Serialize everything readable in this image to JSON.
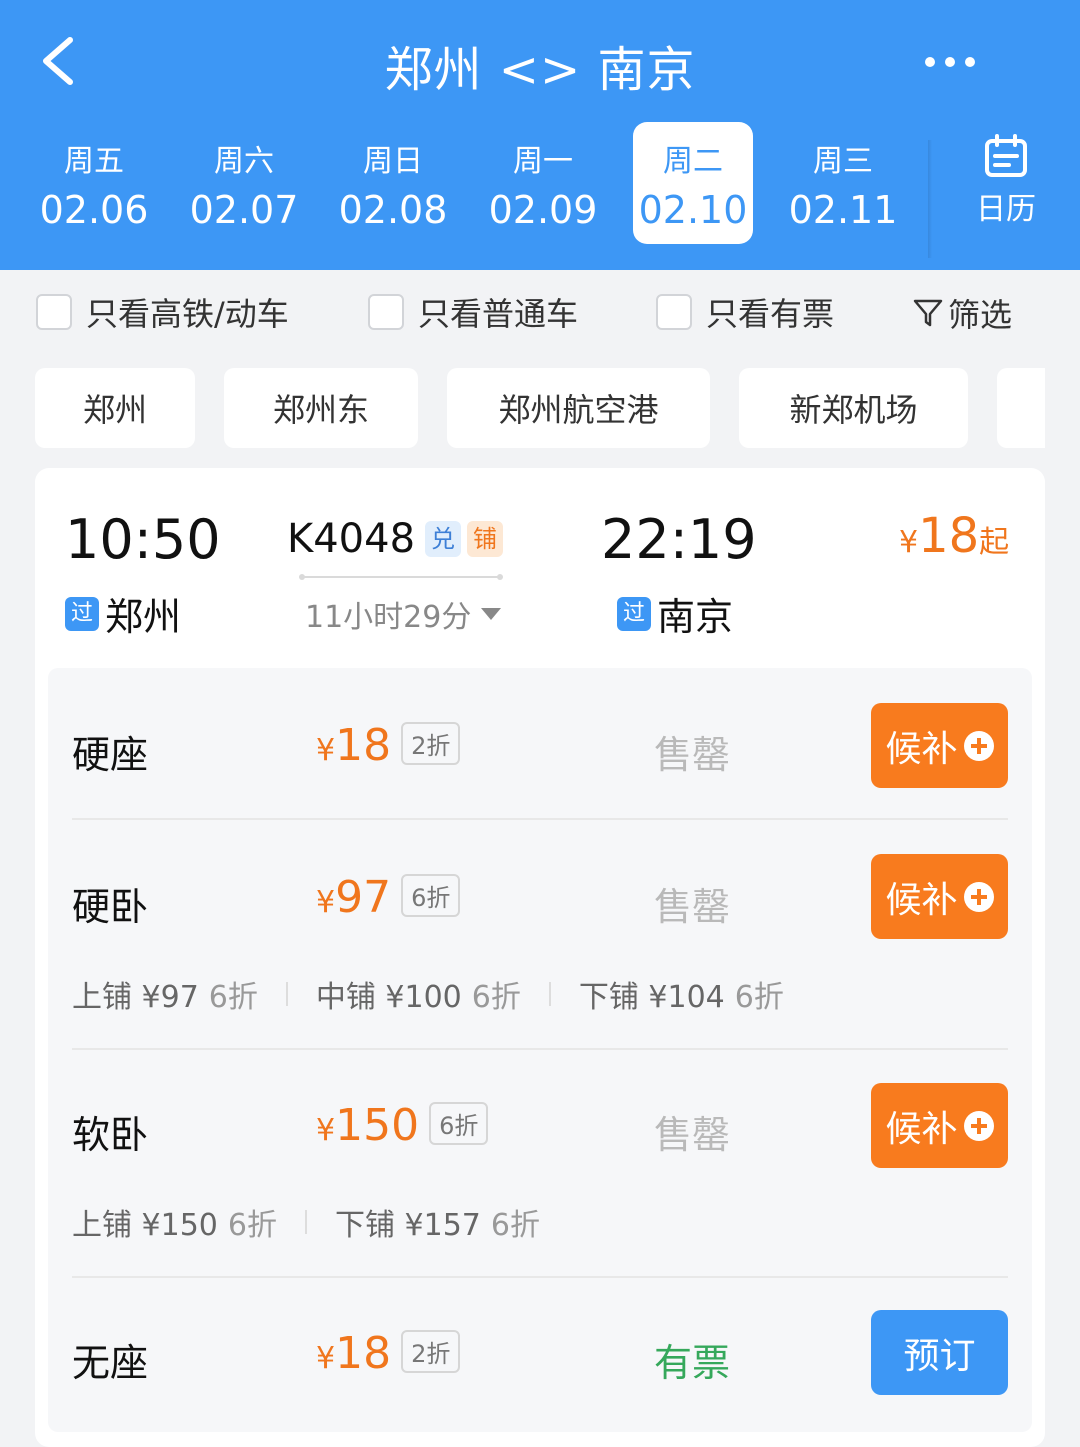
{
  "header": {
    "title": "郑州 <> 南京",
    "back_icon": "chevron-left-icon",
    "more_icon": "more-dots-icon",
    "color": "#3d97f5"
  },
  "dates": [
    {
      "weekday": "周五",
      "date": "02.06",
      "active": false
    },
    {
      "weekday": "周六",
      "date": "02.07",
      "active": false
    },
    {
      "weekday": "周日",
      "date": "02.08",
      "active": false
    },
    {
      "weekday": "周一",
      "date": "02.09",
      "active": false
    },
    {
      "weekday": "周二",
      "date": "02.10",
      "active": true
    },
    {
      "weekday": "周三",
      "date": "02.11",
      "active": false
    }
  ],
  "calendar": {
    "label": "日历",
    "icon": "calendar-icon"
  },
  "filters": {
    "high_speed": "只看高铁/动车",
    "normal": "只看普通车",
    "available": "只看有票",
    "filter": "筛选"
  },
  "stations": [
    "郑州",
    "郑州东",
    "郑州航空港",
    "新郑机场"
  ],
  "train": {
    "dep_time": "10:50",
    "dep_station": "郑州",
    "dep_tag": "过",
    "number": "K4048",
    "badge_dui": "兑",
    "badge_pu": "铺",
    "duration": "11小时29分",
    "arr_time": "22:19",
    "arr_station": "南京",
    "arr_tag": "过",
    "min_price_cur": "¥",
    "min_price": "18",
    "min_price_suffix": "起"
  },
  "seats": [
    {
      "name": "硬座",
      "cur": "¥",
      "price": "18",
      "discount": "2折",
      "status": "售罄",
      "action": "候补"
    },
    {
      "name": "硬卧",
      "cur": "¥",
      "price": "97",
      "discount": "6折",
      "status": "售罄",
      "action": "候补",
      "berths": [
        {
          "label": "上铺 ¥97",
          "discount": "6折"
        },
        {
          "label": "中铺 ¥100",
          "discount": "6折"
        },
        {
          "label": "下铺 ¥104",
          "discount": "6折"
        }
      ]
    },
    {
      "name": "软卧",
      "cur": "¥",
      "price": "150",
      "discount": "6折",
      "status": "售罄",
      "action": "候补",
      "berths": [
        {
          "label": "上铺 ¥150",
          "discount": "6折"
        },
        {
          "label": "下铺 ¥157",
          "discount": "6折"
        }
      ]
    },
    {
      "name": "无座",
      "cur": "¥",
      "price": "18",
      "discount": "2折",
      "status": "有票",
      "action": "预订"
    }
  ],
  "colors": {
    "accent": "#3d97f5",
    "price": "#f0761d",
    "waitlist": "#f87b1e",
    "available": "#35a85b"
  }
}
